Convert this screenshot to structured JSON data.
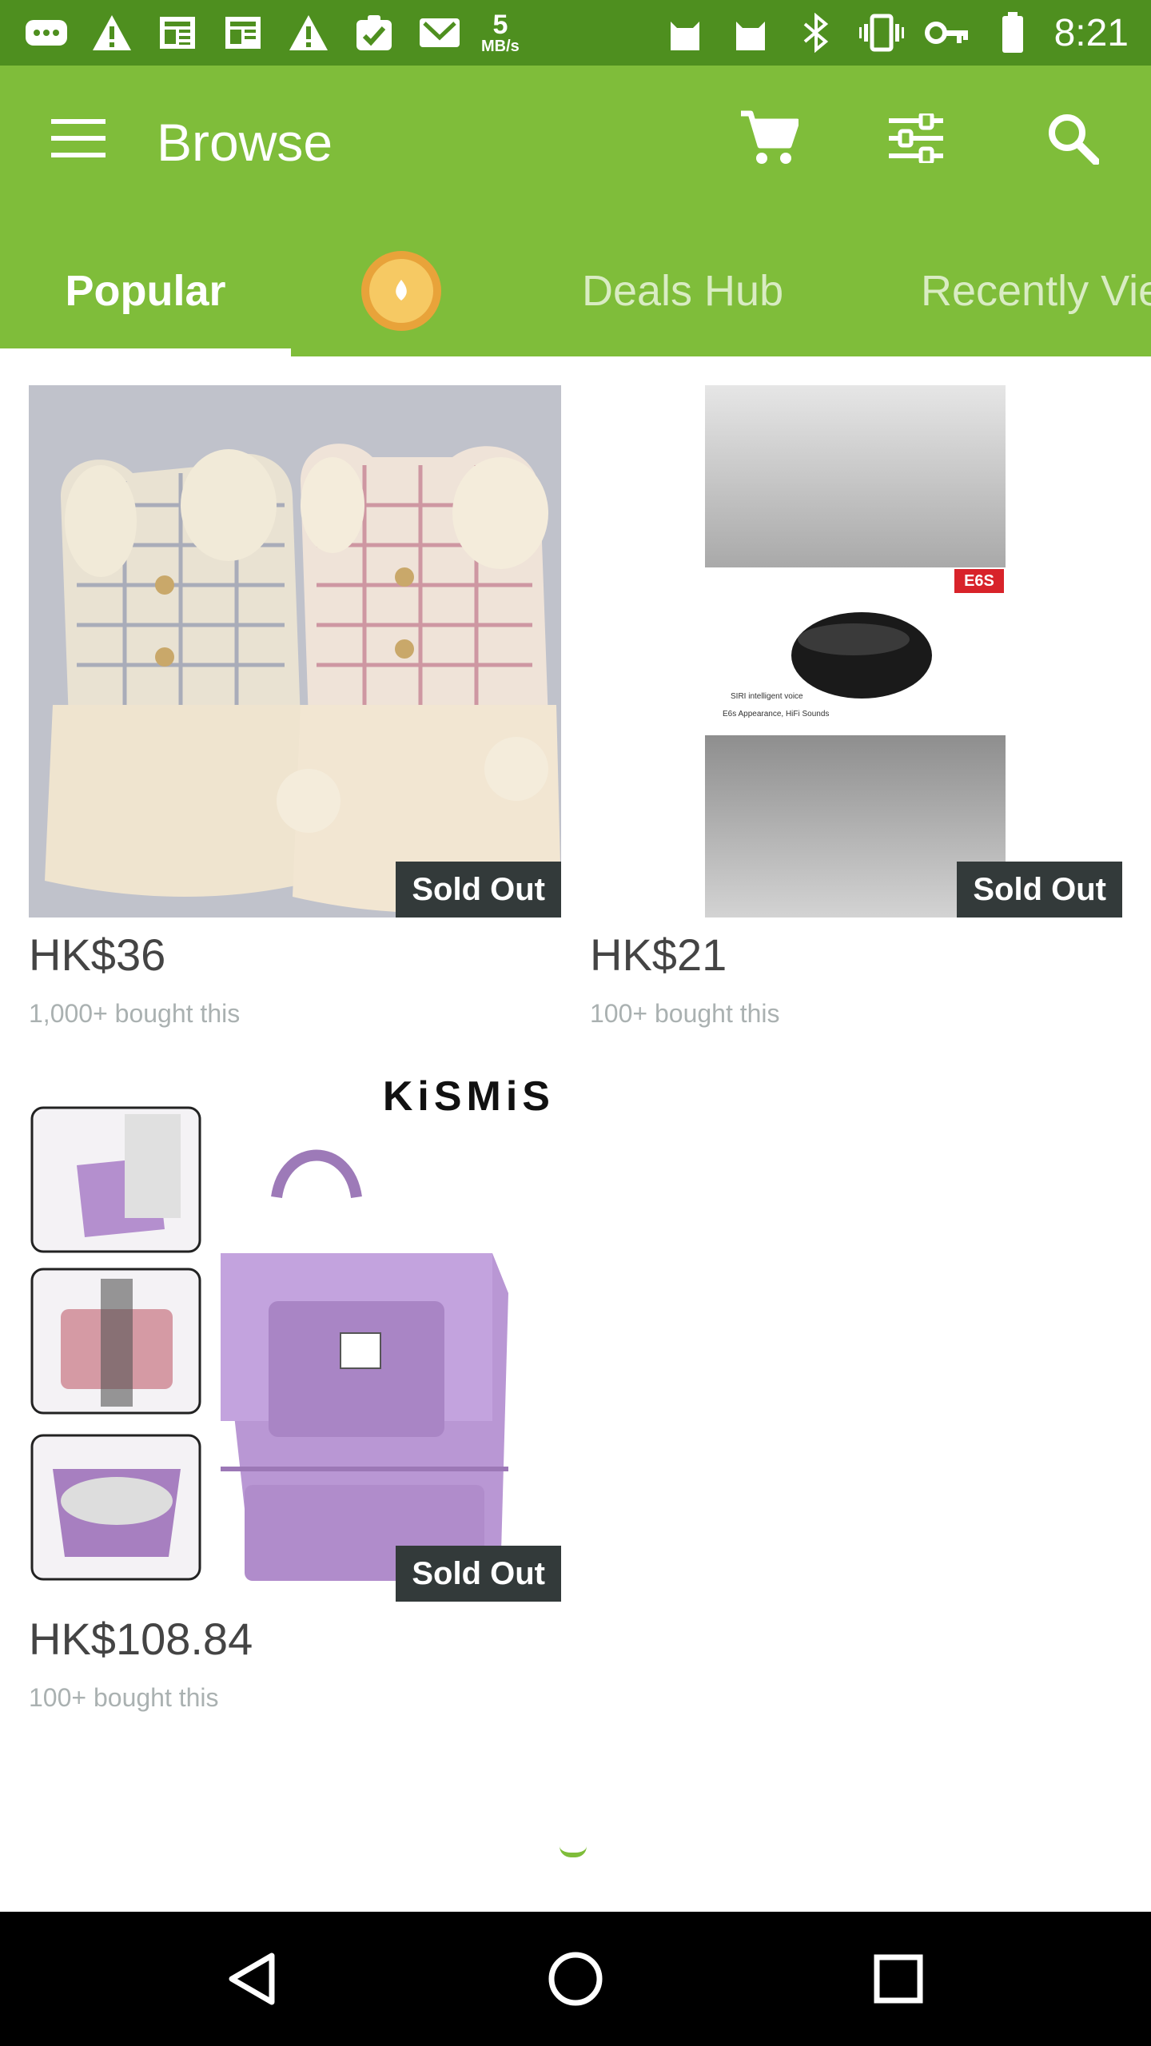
{
  "status_bar": {
    "time": "8:21",
    "net_speed_value": "5",
    "net_speed_unit": "MB/s",
    "left_icons": [
      "messages-icon",
      "warning-icon",
      "news-icon",
      "news-icon",
      "warning-icon",
      "task-icon",
      "mail-icon"
    ],
    "right_icons": [
      "cat-icon",
      "cat-icon",
      "bluetooth-icon",
      "vibrate-icon",
      "key-icon",
      "battery-icon"
    ]
  },
  "app_bar": {
    "title": "Browse",
    "color": "#7fbd3a",
    "icons": [
      "menu-icon",
      "cart-icon",
      "filter-icon",
      "search-icon"
    ]
  },
  "tabs": [
    {
      "label": "Popular",
      "selected": true
    },
    {
      "label": "",
      "icon": "coin-icon",
      "selected": false
    },
    {
      "label": "Deals Hub",
      "selected": false
    },
    {
      "label": "Recently Vie",
      "selected": false
    }
  ],
  "products": [
    {
      "price": "HK$36",
      "bought": "1,000+ bought this",
      "badge": "Sold Out"
    },
    {
      "price": "HK$21",
      "bought": "100+ bought this",
      "badge": "Sold Out",
      "image_texts": {
        "tag": "E6S",
        "line1": "SIRI intelligent voice",
        "line2": "E6s Appearance, HiFi Sounds"
      }
    },
    {
      "price": "HK$108.84",
      "bought": "100+ bought this",
      "badge": "Sold Out",
      "image_texts": {
        "brand": "KiSMiS"
      }
    }
  ],
  "nav_bar": {
    "icons": [
      "back-icon",
      "home-icon",
      "recents-icon"
    ]
  }
}
